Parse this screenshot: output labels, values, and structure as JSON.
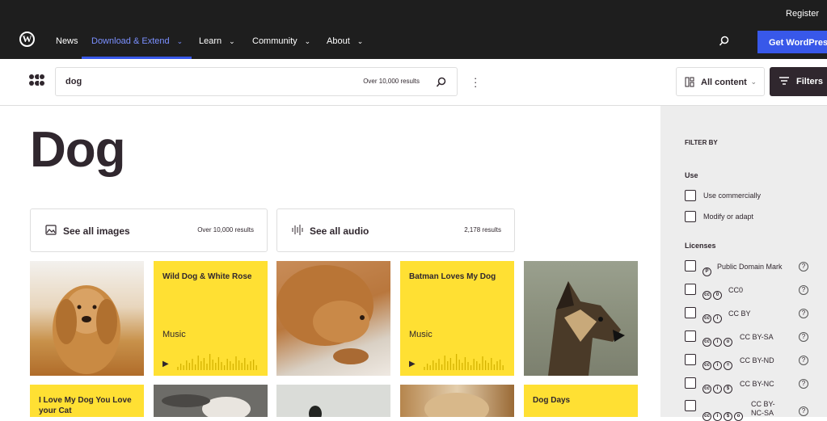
{
  "wp": {
    "register": "Register",
    "nav": [
      {
        "label": "News",
        "chevron": false,
        "active": false
      },
      {
        "label": "Download & Extend",
        "chevron": true,
        "active": true
      },
      {
        "label": "Learn",
        "chevron": true,
        "active": false
      },
      {
        "label": "Community",
        "chevron": true,
        "active": false
      },
      {
        "label": "About",
        "chevron": true,
        "active": false
      }
    ],
    "get_wordpress": "Get WordPress"
  },
  "search": {
    "query": "dog",
    "count": "Over 10,000 results"
  },
  "content_select": "All content",
  "filters_label": "Filters",
  "page_title": "Dog",
  "see_all": {
    "images": {
      "label": "See all images",
      "count": "Over 10,000 results"
    },
    "audio": {
      "label": "See all audio",
      "count": "2,178 results"
    }
  },
  "results": [
    {
      "type": "image",
      "subject": "golden-retriever"
    },
    {
      "type": "audio",
      "title": "Wild Dog & White Rose",
      "category": "Music"
    },
    {
      "type": "image",
      "subject": "lying-golden-dog"
    },
    {
      "type": "audio",
      "title": "Batman Loves My Dog",
      "category": "Music"
    },
    {
      "type": "image",
      "subject": "african-wild-dog"
    },
    {
      "type": "audio",
      "title": "I Love My Dog You Love your Cat"
    },
    {
      "type": "image",
      "subject": "dog-on-floor"
    },
    {
      "type": "image",
      "subject": "dark-dog"
    },
    {
      "type": "image",
      "subject": "fluffy-dog"
    },
    {
      "type": "audio",
      "title": "Dog Days"
    }
  ],
  "sidebar": {
    "title": "FILTER BY",
    "use_heading": "Use",
    "use": [
      "Use commercially",
      "Modify or adapt"
    ],
    "licenses_heading": "Licenses",
    "licenses": [
      "Public Domain Mark",
      "CC0",
      "CC BY",
      "CC BY-SA",
      "CC BY-ND",
      "CC BY-NC",
      "CC BY-NC-SA"
    ]
  },
  "colors": {
    "wp_bar": "#1e1e1e",
    "accent_blue": "#3858e9",
    "audio_yellow": "#ffe033",
    "sidebar_bg": "#ededed",
    "text_dark": "#30272e"
  }
}
